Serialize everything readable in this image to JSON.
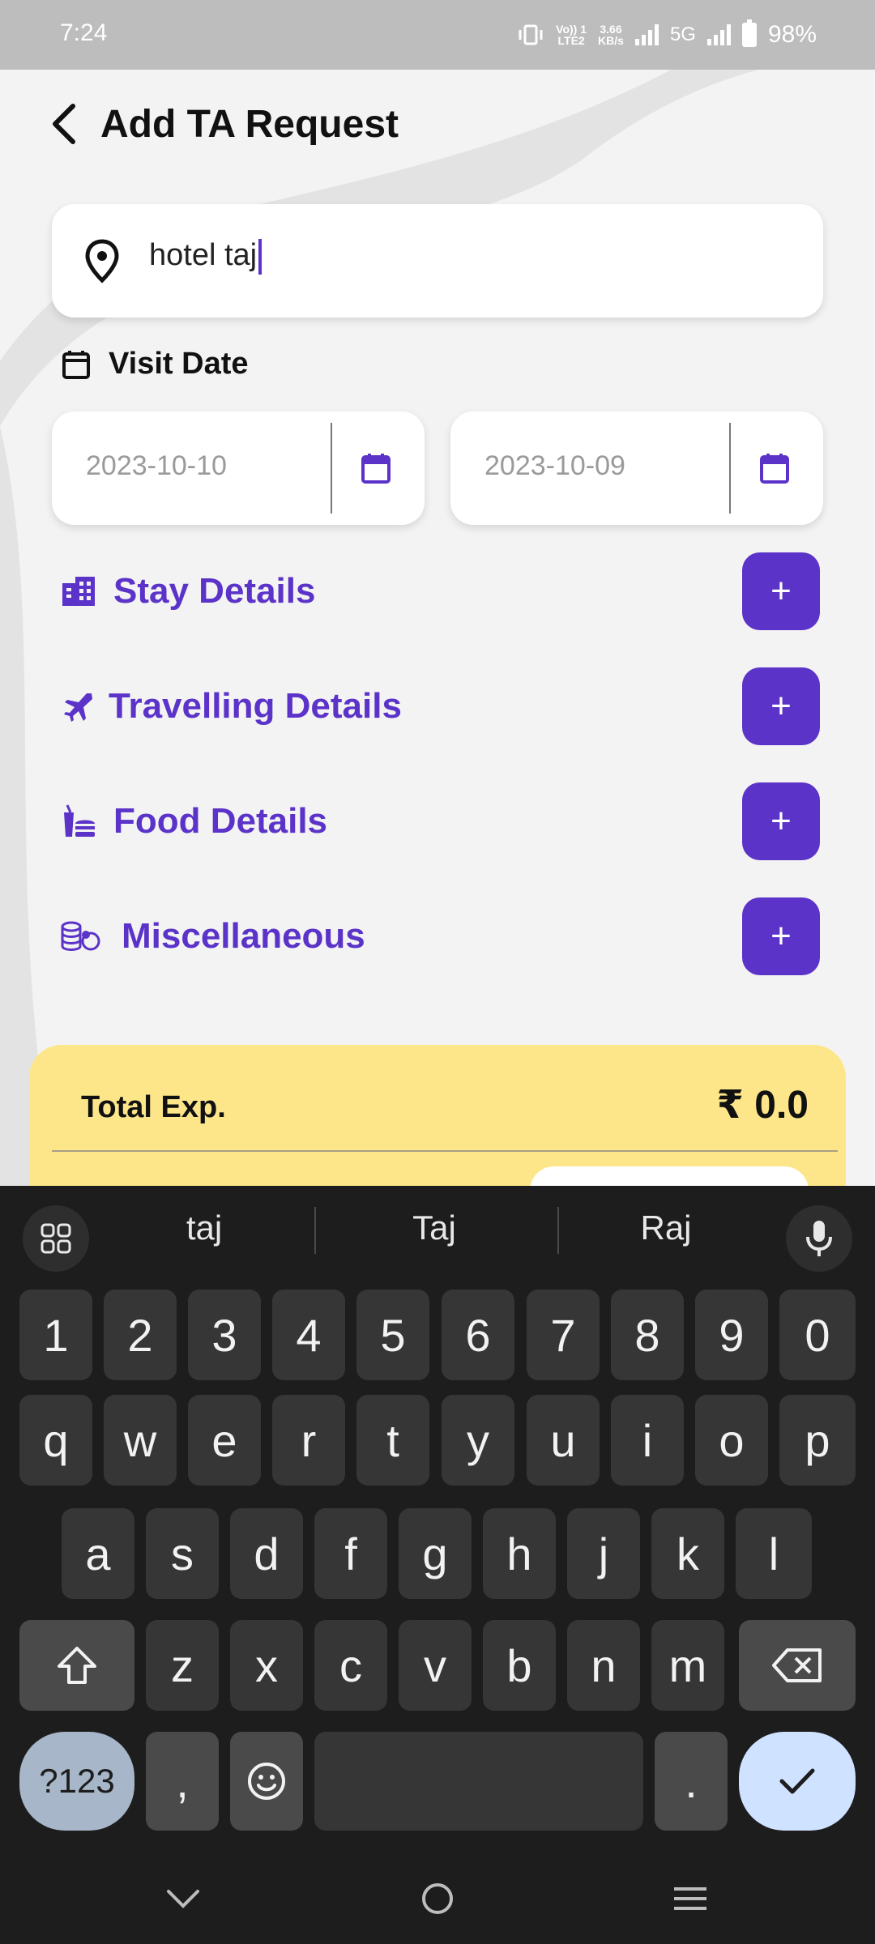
{
  "status_bar": {
    "time": "7:24",
    "network_top": "Vo)) 1",
    "network_bottom": "LTE2",
    "speed_top": "3.66",
    "speed_bottom": "KB/s",
    "network_type": "5G",
    "battery": "98%"
  },
  "header": {
    "title": "Add TA Request",
    "back_icon": "chevron-left-icon"
  },
  "search": {
    "value": "hotel taj",
    "icon": "location-pin-icon"
  },
  "visit_date": {
    "label": "Visit Date",
    "from": "2023-10-10",
    "to": "2023-10-09"
  },
  "sections": [
    {
      "label": "Stay Details",
      "icon": "hotel-icon",
      "action": "+"
    },
    {
      "label": "Travelling Details",
      "icon": "airplane-icon",
      "action": "+"
    },
    {
      "label": "Food Details",
      "icon": "food-icon",
      "action": "+"
    },
    {
      "label": "Miscellaneous",
      "icon": "coins-icon",
      "action": "+"
    }
  ],
  "total": {
    "label": "Total Exp.",
    "value": "₹ 0.0"
  },
  "keyboard": {
    "suggestions": [
      "taj",
      "Taj",
      "Raj"
    ],
    "row_numbers": [
      "1",
      "2",
      "3",
      "4",
      "5",
      "6",
      "7",
      "8",
      "9",
      "0"
    ],
    "row1": [
      "q",
      "w",
      "e",
      "r",
      "t",
      "y",
      "u",
      "i",
      "o",
      "p"
    ],
    "row2": [
      "a",
      "s",
      "d",
      "f",
      "g",
      "h",
      "j",
      "k",
      "l"
    ],
    "row3": [
      "z",
      "x",
      "c",
      "v",
      "b",
      "n",
      "m"
    ],
    "symbols": "?123",
    "comma": ",",
    "period": "."
  },
  "colors": {
    "accent": "#5b33c9",
    "total_bg": "#fde68a",
    "keyboard_bg": "#1d1d1d"
  }
}
